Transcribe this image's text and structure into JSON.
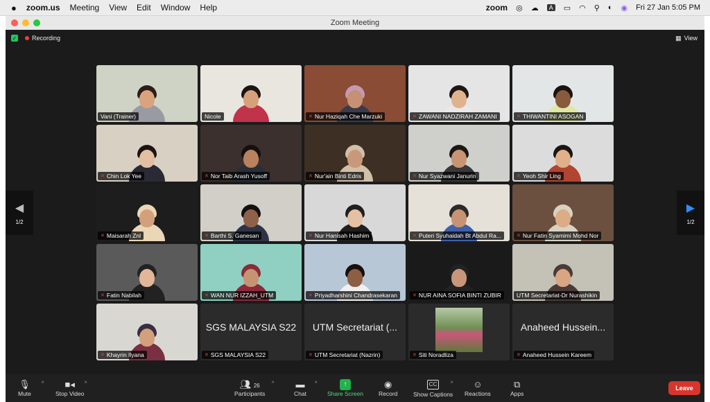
{
  "menubar": {
    "apple_icon": "apple-icon",
    "app_name": "zoom.us",
    "items": [
      "Meeting",
      "View",
      "Edit",
      "Window",
      "Help"
    ],
    "zoom_label": "zoom",
    "datetime": "Fri 27 Jan  5:05 PM",
    "status_glyph": "A"
  },
  "window": {
    "title": "Zoom Meeting"
  },
  "topstrip": {
    "recording_label": "Recording",
    "view_label": "View"
  },
  "pagination": {
    "left_page": "1/2",
    "right_page": "1/2"
  },
  "tiles": [
    {
      "name": "Vani (Trainer)",
      "bg": "#cfd3c6",
      "skin": "#d9a37e",
      "shirt": "#9a9aa2",
      "hair": "#2b1d17",
      "active": true,
      "muted": false
    },
    {
      "name": "Nicole",
      "bg": "#e9e6df",
      "skin": "#d6a07a",
      "shirt": "#c0334a",
      "hair": "#1a1412",
      "muted": false
    },
    {
      "name": "Nur Haziqah Che Marzuki",
      "bg": "#8a4c35",
      "skin": "#c69072",
      "shirt": "#3a3a4a",
      "hair": "#c49ab3",
      "muted": true
    },
    {
      "name": "ZAWANI NADZIRAH ZAMANI",
      "bg": "#e5e5e5",
      "skin": "#e0b38f",
      "shirt": "#e9e9e9",
      "hair": "#1f1714",
      "muted": true
    },
    {
      "name": "THIWANTINI ASOGAN",
      "bg": "#e3e6e6",
      "skin": "#8a5a3d",
      "shirt": "#dfe8a5",
      "hair": "#1a1311",
      "muted": true
    },
    {
      "name": "Chin Lok Yee",
      "bg": "#d9d0c4",
      "skin": "#e4bea0",
      "shirt": "#2a2a35",
      "hair": "#1b1412",
      "muted": true
    },
    {
      "name": "Nor Taib Arash Yusoff",
      "bg": "#3b302e",
      "skin": "#b7825d",
      "shirt": "#2a2e36",
      "hair": "#141010",
      "muted": true
    },
    {
      "name": "Nur'ain Binti Edris",
      "bg": "#3e2f24",
      "skin": "#c9987a",
      "shirt": "#d1bfa8",
      "hair": "#d1bfa8",
      "muted": true
    },
    {
      "name": "Nur Syazwani Janurin",
      "bg": "#cfd0cb",
      "skin": "#c89574",
      "shirt": "#383838",
      "hair": "#1c1715",
      "muted": true
    },
    {
      "name": "Yeoh Shir Ling",
      "bg": "#dcdcdc",
      "skin": "#e0b08a",
      "shirt": "#b24432",
      "hair": "#1a1413",
      "muted": true
    },
    {
      "name": "Maisarah Znl",
      "bg": "#1d1d1d",
      "skin": "#d3a07c",
      "shirt": "#ead7b6",
      "hair": "#ead7b6",
      "muted": true
    },
    {
      "name": "Barthi S. Ganesan",
      "bg": "#d2cfc8",
      "skin": "#8f6148",
      "shirt": "#2e3446",
      "hair": "#111",
      "muted": true
    },
    {
      "name": "Nur Hanisah Hashim",
      "bg": "#d8d8d8",
      "skin": "#e6c0a2",
      "shirt": "#1f1f1f",
      "hair": "#1f1f1f",
      "muted": true
    },
    {
      "name": "Puteri Syuhaidah Bt Abdul Ra...",
      "bg": "#e5e0d8",
      "skin": "#c89372",
      "shirt": "#4060a8",
      "hair": "#2a2a2a",
      "muted": true
    },
    {
      "name": "Nur Fatin Syamimi Mohd Nor",
      "bg": "#6b5040",
      "skin": "#dcac86",
      "shirt": "#d9d2c2",
      "hair": "#d9d2c2",
      "muted": true
    },
    {
      "name": "Fatin Nabilah",
      "bg": "#5a5a5a",
      "skin": "#e4b699",
      "shirt": "#222",
      "hair": "#222",
      "muted": true
    },
    {
      "name": "WAN NUR IZZAH_UTM",
      "bg": "#8fd0c2",
      "skin": "#c79473",
      "shirt": "#8a2a3a",
      "hair": "#8a2a3a",
      "muted": true
    },
    {
      "name": "Priyadharshini Chandrasekaran",
      "bg": "#b7c7d6",
      "skin": "#8c5e43",
      "shirt": "#f0f0f0",
      "hair": "#160f0d",
      "muted": true
    },
    {
      "name": "NUR AINA SOFIA BINTI ZUBIR",
      "bg": "#1a1a1a",
      "skin": "#c8977a",
      "shirt": "#222",
      "hair": "#222",
      "muted": true
    },
    {
      "name": "UTM Secretariat-Dr Nurashikin",
      "bg": "#c4c1b7",
      "skin": "#d8a682",
      "shirt": "#4a3a38",
      "hair": "#4a3a38",
      "muted": false
    },
    {
      "name": "Khayrin Ilyana",
      "bg": "#d9d7d2",
      "skin": "#d2a07c",
      "shirt": "#7a2f42",
      "hair": "#3a2e44",
      "muted": true
    },
    {
      "name": "SGS MALAYSIA S22",
      "big": "SGS MALAYSIA S22",
      "muted": true
    },
    {
      "name": "UTM Secretariat (Nazrin)",
      "big": "UTM Secretariat (...",
      "muted": true
    },
    {
      "name": "Siti Noradliza",
      "photo": true,
      "muted": true
    },
    {
      "name": "Anaheed Hussein Kareem",
      "big": "Anaheed Hussein...",
      "muted": true
    }
  ],
  "toolbar": {
    "mute": "Mute",
    "stop_video": "Stop Video",
    "participants": "Participants",
    "participant_count": "26",
    "chat": "Chat",
    "share_screen": "Share Screen",
    "record": "Record",
    "show_captions": "Show Captions",
    "captions_glyph": "CC",
    "reactions": "Reactions",
    "apps": "Apps",
    "leave": "Leave"
  }
}
